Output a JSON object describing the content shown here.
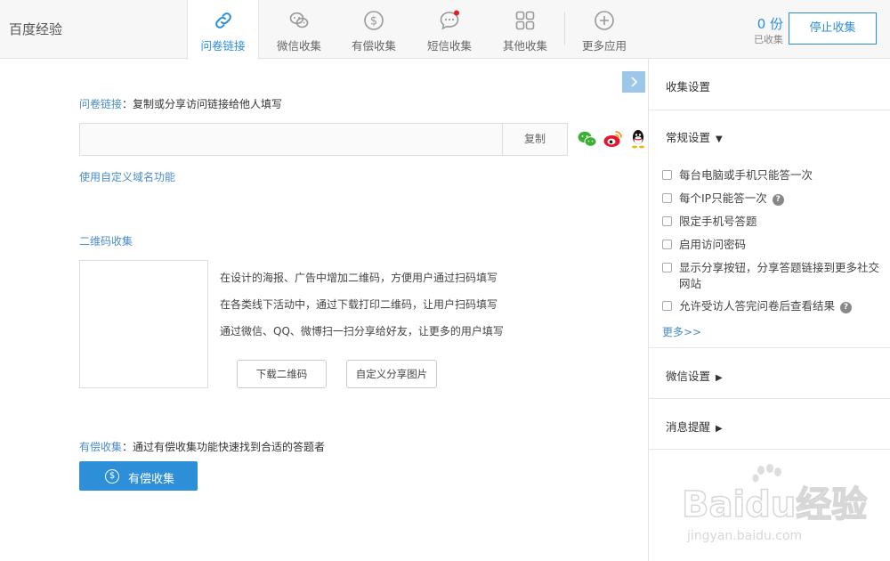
{
  "app": {
    "title": "百度经验"
  },
  "tabs": [
    {
      "label": "问卷链接",
      "icon": "link-icon",
      "active": true
    },
    {
      "label": "微信收集",
      "icon": "wechat-icon",
      "active": false
    },
    {
      "label": "有偿收集",
      "icon": "dollar-icon",
      "active": false
    },
    {
      "label": "短信收集",
      "icon": "sms-icon",
      "active": false
    },
    {
      "label": "其他收集",
      "icon": "grid-icon",
      "active": false
    },
    {
      "label": "更多应用",
      "icon": "plus-circle-icon",
      "active": false
    }
  ],
  "collected": {
    "count": "0 份",
    "label": "已收集"
  },
  "stop_button": "停止收集",
  "link_section": {
    "title": "问卷链接",
    "desc": "：复制或分享访问链接给他人填写",
    "input_value": "",
    "copy_button": "复制",
    "share_icons": [
      "wechat-icon",
      "weibo-icon",
      "qq-icon"
    ],
    "custom_domain": "使用自定义域名功能"
  },
  "qr_section": {
    "title": "二维码收集",
    "lines": [
      "在设计的海报、广告中增加二维码，方便用户通过扫码填写",
      "在各类线下活动中，通过下载打印二维码，让用户扫码填写",
      "通过微信、QQ、微博扫一扫分享给好友，让更多的用户填写"
    ],
    "download_button": "下载二维码",
    "custom_share_button": "自定义分享图片"
  },
  "paid_section": {
    "title": "有偿收集",
    "desc": "：通过有偿收集功能快速找到合适的答题者",
    "button": "有偿收集"
  },
  "panel": {
    "title": "收集设置",
    "general": "常规设置",
    "options": [
      {
        "label": "每台电脑或手机只能答一次",
        "checked": false,
        "help": false
      },
      {
        "label": "每个IP只能答一次",
        "checked": false,
        "help": true
      },
      {
        "label": "限定手机号答题",
        "checked": false,
        "help": false
      },
      {
        "label": "启用访问密码",
        "checked": false,
        "help": false
      },
      {
        "label": "显示分享按钮，分享答题链接到更多社交网站",
        "checked": false,
        "help": false
      },
      {
        "label": "允许受访人答完问卷后查看结果",
        "checked": false,
        "help": true
      }
    ],
    "more": "更多>>",
    "wechat_settings": "微信设置",
    "notification": "消息提醒"
  },
  "watermark": {
    "text": "Baidu经验",
    "url": "jingyan.baidu.com"
  },
  "colors": {
    "accent": "#2e8fd9",
    "link": "#4a8cc7",
    "notify_dot": "#e02020"
  }
}
